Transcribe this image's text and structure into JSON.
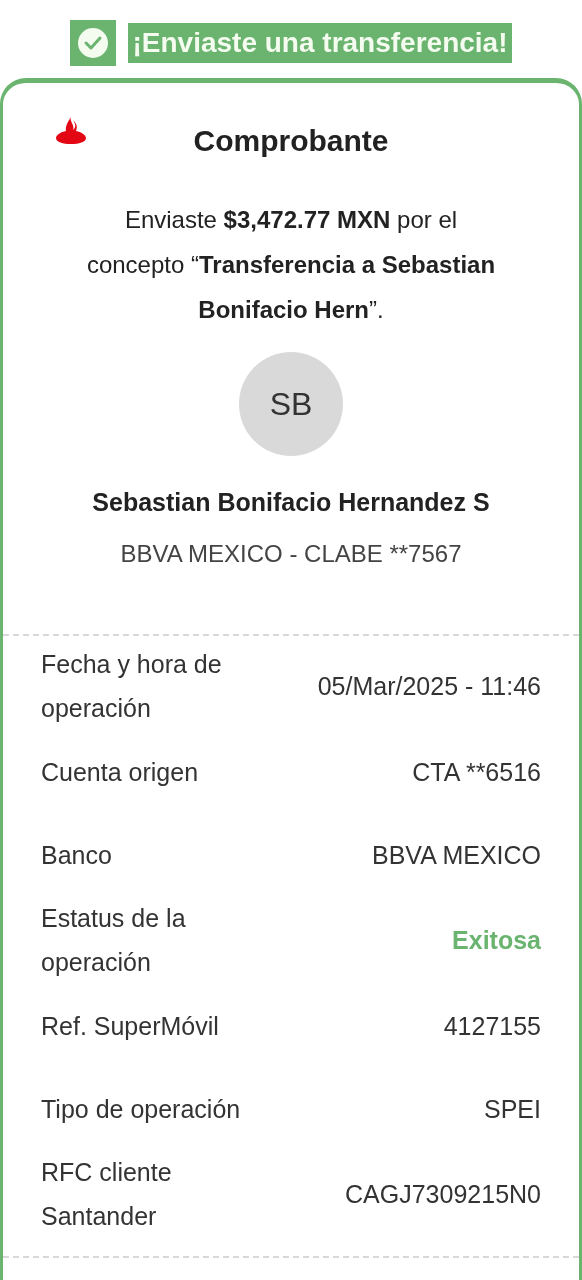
{
  "banner": {
    "text": "¡Enviaste una transferencia!"
  },
  "receipt": {
    "title": "Comprobante",
    "message": "Enviaste **$3,472.77 MXN** por el concepto “**Transferencia a Sebastian Bonifacio Hern**”.",
    "avatar_initials": "SB",
    "recipient_name": "Sebastian Bonifacio Hernandez S",
    "recipient_account": "BBVA MEXICO - CLABE **7567",
    "details": [
      {
        "label": "Fecha y hora de operación",
        "value": "05/Mar/2025 - 11:46",
        "kind": "plain"
      },
      {
        "label": "Cuenta origen",
        "value": "CTA **6516",
        "kind": "plain"
      },
      {
        "label": "Banco",
        "value": "BBVA MEXICO",
        "kind": "plain"
      },
      {
        "label": "Estatus de la operación",
        "value": "Exitosa",
        "kind": "status"
      },
      {
        "label": "Ref. SuperMóvil",
        "value": "4127155",
        "kind": "plain"
      },
      {
        "label": "Tipo de operación",
        "value": "SPEI",
        "kind": "plain"
      },
      {
        "label": "RFC cliente Santander",
        "value": "CAGJ7309215N0",
        "kind": "plain"
      }
    ]
  }
}
